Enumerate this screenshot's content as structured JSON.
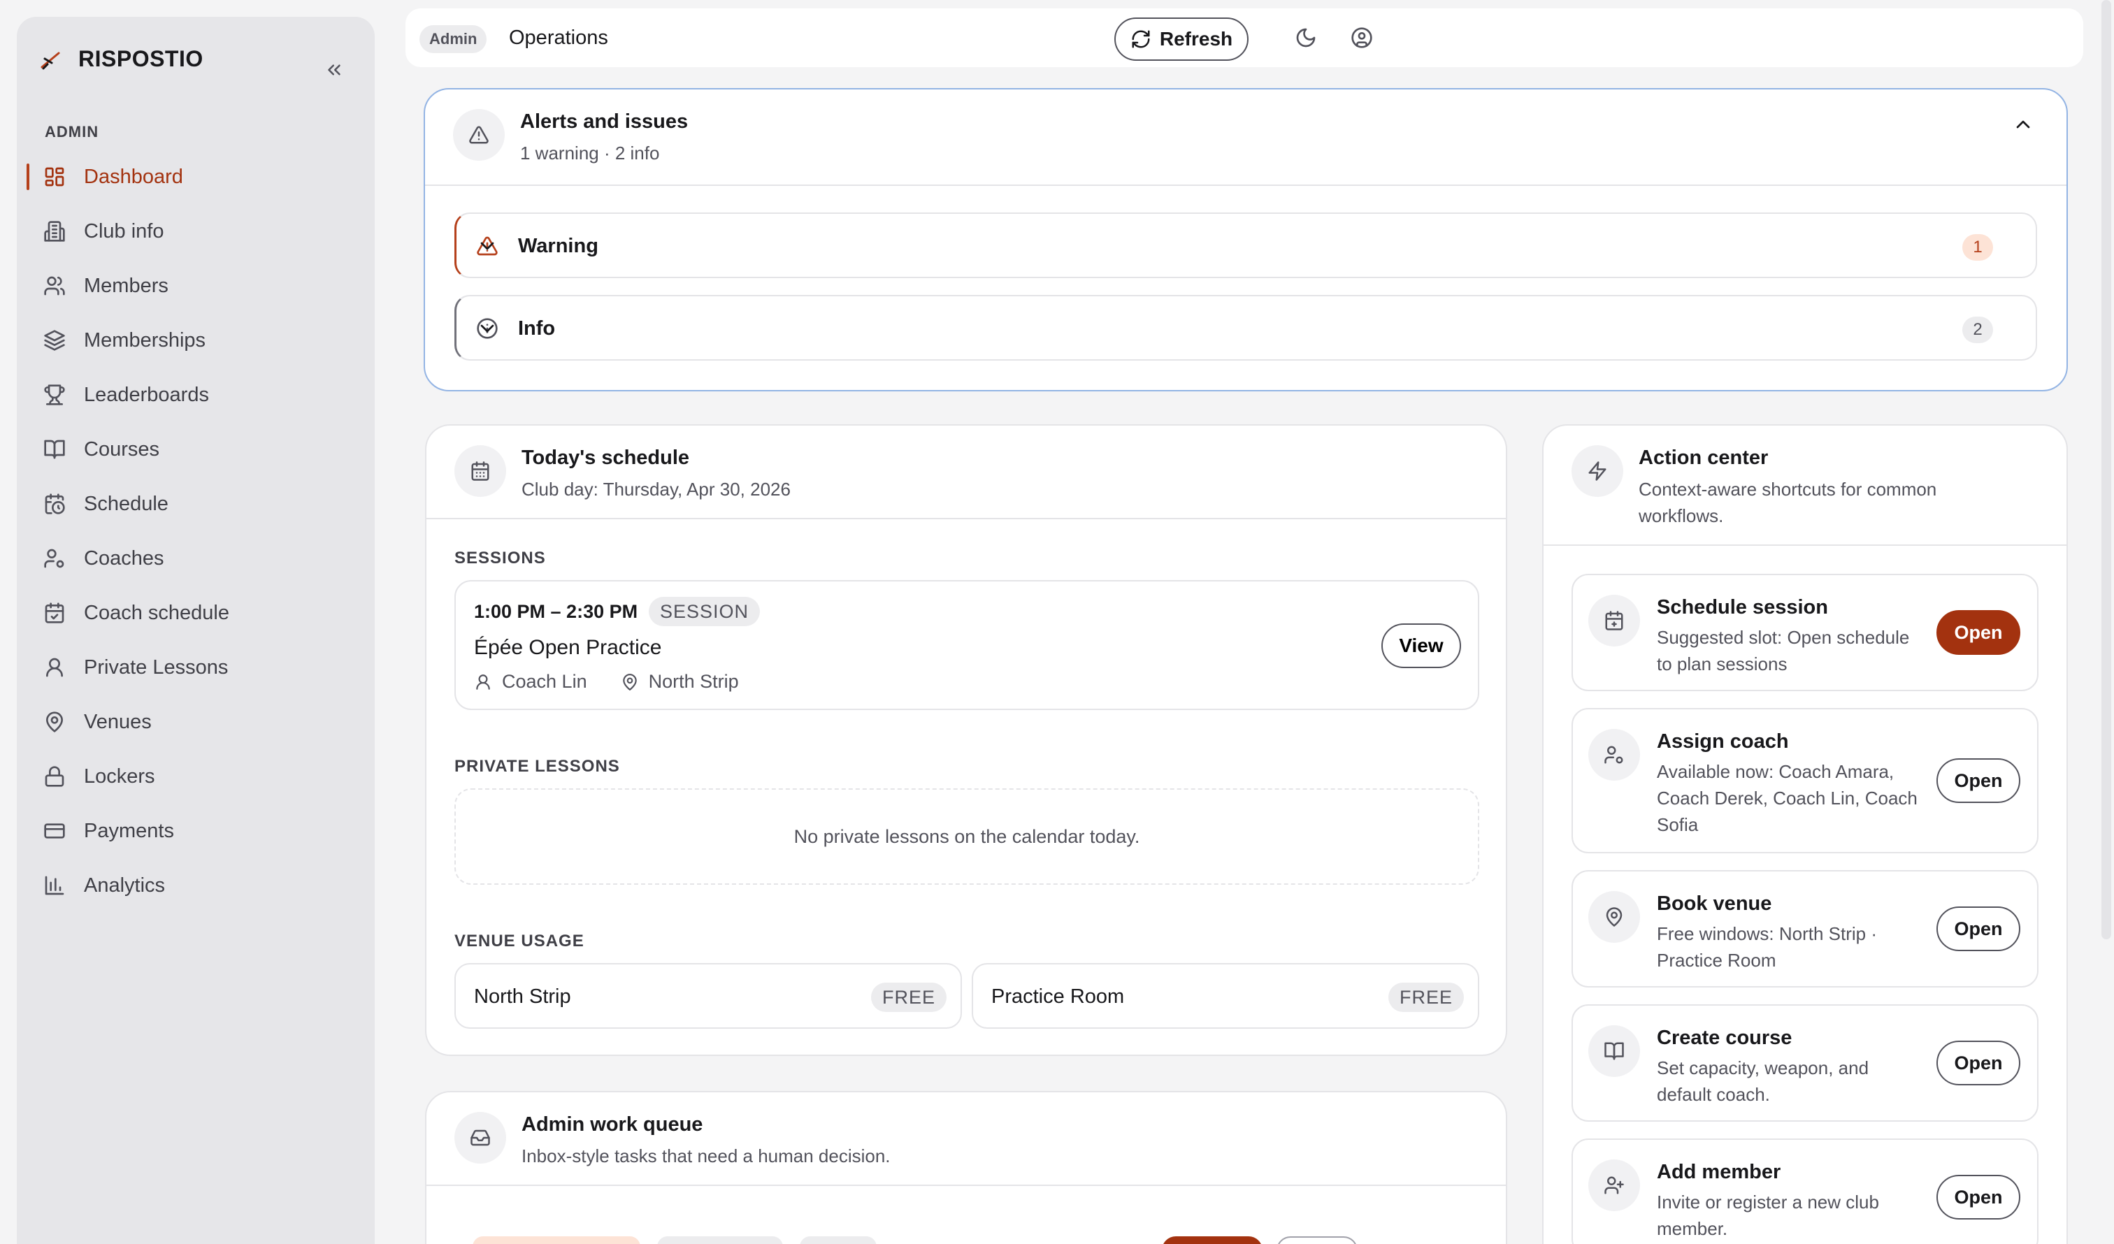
{
  "sidebar": {
    "brand": "RISPOSTIO",
    "section": "ADMIN",
    "items": [
      {
        "label": "Dashboard"
      },
      {
        "label": "Club info"
      },
      {
        "label": "Members"
      },
      {
        "label": "Memberships"
      },
      {
        "label": "Leaderboards"
      },
      {
        "label": "Courses"
      },
      {
        "label": "Schedule"
      },
      {
        "label": "Coaches"
      },
      {
        "label": "Coach schedule"
      },
      {
        "label": "Private Lessons"
      },
      {
        "label": "Venues"
      },
      {
        "label": "Lockers"
      },
      {
        "label": "Payments"
      },
      {
        "label": "Analytics"
      }
    ]
  },
  "topbar": {
    "badge": "Admin",
    "title": "Operations",
    "refresh_label": "Refresh"
  },
  "alerts": {
    "title": "Alerts and issues",
    "subtitle": "1 warning · 2 info",
    "rows": [
      {
        "label": "Warning",
        "count": "1"
      },
      {
        "label": "Info",
        "count": "2"
      }
    ]
  },
  "schedule": {
    "title": "Today's schedule",
    "subtitle": "Club day: Thursday, Apr 30, 2026",
    "sessions_label": "SESSIONS",
    "session": {
      "time": "1:00 PM – 2:30 PM",
      "tag": "SESSION",
      "name": "Épée Open Practice",
      "coach": "Coach Lin",
      "venue": "North Strip",
      "view_label": "View"
    },
    "private_label": "PRIVATE LESSONS",
    "private_empty": "No private lessons on the calendar today.",
    "venue_label": "VENUE USAGE",
    "venues": [
      {
        "name": "North Strip",
        "status": "FREE"
      },
      {
        "name": "Practice Room",
        "status": "FREE"
      }
    ]
  },
  "action_center": {
    "title": "Action center",
    "subtitle": "Context-aware shortcuts for common workflows.",
    "items": [
      {
        "title": "Schedule session",
        "sub": "Suggested slot: Open schedule to plan sessions",
        "button": "Open"
      },
      {
        "title": "Assign coach",
        "sub": "Available now: Coach Amara, Coach Derek, Coach Lin, Coach Sofia",
        "button": "Open"
      },
      {
        "title": "Book venue",
        "sub": "Free windows: North Strip · Practice Room",
        "button": "Open"
      },
      {
        "title": "Create course",
        "sub": "Set capacity, weapon, and default coach.",
        "button": "Open"
      },
      {
        "title": "Add member",
        "sub": "Invite or register a new club member.",
        "button": "Open"
      }
    ]
  },
  "queue": {
    "title": "Admin work queue",
    "subtitle": "Inbox-style tasks that need a human decision."
  },
  "colors": {
    "accent": "#a3320f",
    "warning_bg": "#fde3d6",
    "alerts_border": "#93b4e4"
  }
}
